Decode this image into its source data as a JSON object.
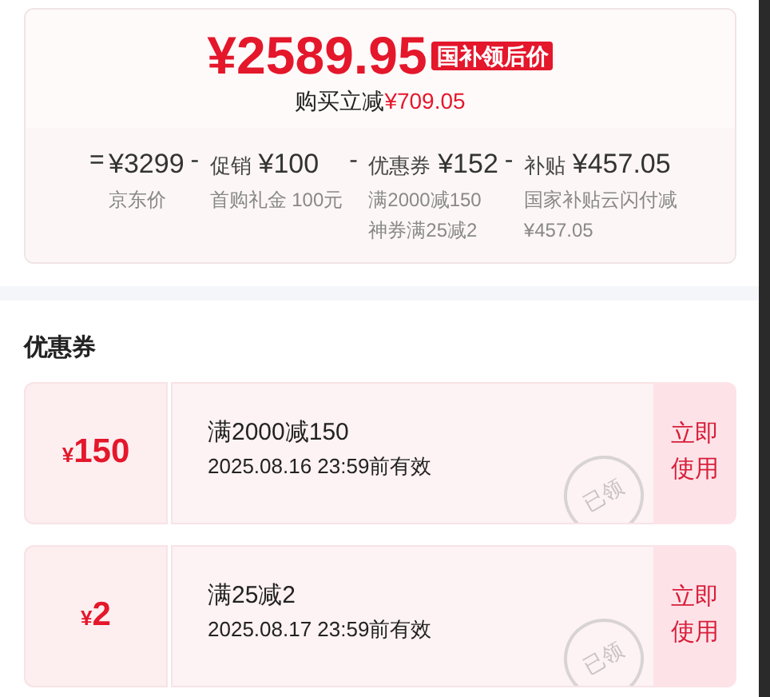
{
  "price_card": {
    "final_price": "¥2589.95",
    "price_badge": "国补领后价",
    "savings_label": "购买立减",
    "savings_amount": "¥709.05",
    "breakdown": [
      {
        "operator": "=",
        "amount": "¥3299",
        "notes": [
          "京东价"
        ]
      },
      {
        "operator": "-",
        "label": "促销",
        "amount": "¥100",
        "notes": [
          "首购礼金 100元"
        ]
      },
      {
        "operator": "-",
        "label": "优惠券",
        "amount": "¥152",
        "notes": [
          "满2000减150",
          "神券满25减2"
        ]
      },
      {
        "operator": "-",
        "label": "补贴",
        "amount": "¥457.05",
        "notes": [
          "国家补贴云闪付减",
          "¥457.05"
        ]
      }
    ]
  },
  "coupons_section": {
    "title": "优惠券",
    "coupons": [
      {
        "currency": "¥",
        "value": "150",
        "condition": "满2000减150",
        "validity": "2025.08.16 23:59前有效",
        "claimed": true,
        "stamp": "已领",
        "action": "立即使用"
      },
      {
        "currency": "¥",
        "value": "2",
        "condition": "满25减2",
        "validity": "2025.08.17 23:59前有效",
        "claimed": true,
        "stamp": "已领",
        "action": "立即使用"
      }
    ]
  }
}
